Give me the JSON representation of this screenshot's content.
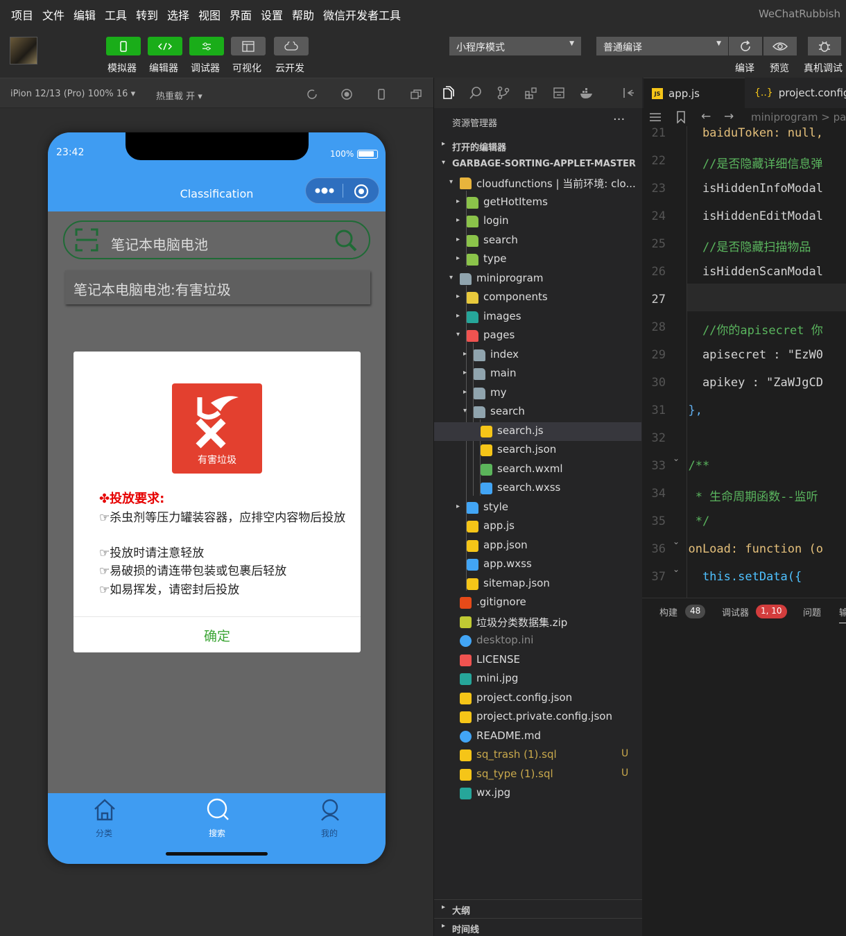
{
  "menu": {
    "items": [
      "项目",
      "文件",
      "编辑",
      "工具",
      "转到",
      "选择",
      "视图",
      "界面",
      "设置",
      "帮助",
      "微信开发者工具"
    ],
    "window_title": "WeChatRubbish"
  },
  "toolbar": {
    "buttons": [
      {
        "label": "模拟器",
        "icon": "phone-icon"
      },
      {
        "label": "编辑器",
        "icon": "code-icon"
      },
      {
        "label": "调试器",
        "icon": "sliders-icon"
      },
      {
        "label": "可视化",
        "icon": "layout-icon"
      },
      {
        "label": "云开发",
        "icon": "cloud-icon"
      }
    ],
    "mode_select": "小程序模式",
    "compile_select": "普通编译",
    "compile_label": "编译",
    "preview_label": "预览",
    "debug_label": "真机调试"
  },
  "simulator": {
    "device": "iPion 12/13 (Pro) 100% 16 ▾",
    "hotreload": "热重载 开 ▾"
  },
  "phone": {
    "time": "23:42",
    "battery": "100%",
    "title": "Classification",
    "search_value": "笔记本电脑电池",
    "result": "笔记本电脑电池:有害垃圾",
    "modal": {
      "logo_label": "有害垃圾",
      "req_title": "✤投放要求:",
      "requirements": [
        "☞杀虫剂等压力罐装容器，应排空内容物后投放",
        "☞投放时请注意轻放",
        "☞易破损的请连带包装或包裹后轻放",
        "☞如易挥发，请密封后投放"
      ],
      "confirm": "确定"
    },
    "tabs": [
      {
        "label": "分类"
      },
      {
        "label": "搜索"
      },
      {
        "label": "我的"
      }
    ]
  },
  "explorer": {
    "title": "资源管理器",
    "dots": "···",
    "open_editors": "打开的编辑器",
    "project": "GARBAGE-SORTING-APPLET-MASTER",
    "outline": "大纲",
    "timeline": "时间线",
    "tree": [
      {
        "name": "cloudfunctions | 当前环境: clo...",
        "depth": 1,
        "arrow": "▾",
        "icon": "folder-cloud-icon",
        "color": "#e8b43c"
      },
      {
        "name": "getHotItems",
        "depth": 2,
        "arrow": "▸",
        "icon": "folder-cloud-icon",
        "color": "#8bc34a"
      },
      {
        "name": "login",
        "depth": 2,
        "arrow": "▸",
        "icon": "folder-cloud-icon",
        "color": "#8bc34a"
      },
      {
        "name": "search",
        "depth": 2,
        "arrow": "▸",
        "icon": "folder-cloud-icon",
        "color": "#8bc34a"
      },
      {
        "name": "type",
        "depth": 2,
        "arrow": "▸",
        "icon": "folder-cloud-icon",
        "color": "#8bc34a"
      },
      {
        "name": "miniprogram",
        "depth": 1,
        "arrow": "▾",
        "icon": "folder-open-icon",
        "color": "#90a4ae"
      },
      {
        "name": "components",
        "depth": 2,
        "arrow": "▸",
        "icon": "folder-components-icon",
        "color": "#e8c93c"
      },
      {
        "name": "images",
        "depth": 2,
        "arrow": "▸",
        "icon": "folder-images-icon",
        "color": "#26a69a"
      },
      {
        "name": "pages",
        "depth": 2,
        "arrow": "▾",
        "icon": "folder-pages-icon",
        "color": "#ef5350"
      },
      {
        "name": "index",
        "depth": 3,
        "arrow": "▸",
        "icon": "folder-icon",
        "color": "#90a4ae"
      },
      {
        "name": "main",
        "depth": 3,
        "arrow": "▸",
        "icon": "folder-icon",
        "color": "#90a4ae"
      },
      {
        "name": "my",
        "depth": 3,
        "arrow": "▸",
        "icon": "folder-icon",
        "color": "#90a4ae"
      },
      {
        "name": "search",
        "depth": 3,
        "arrow": "▾",
        "icon": "folder-open-icon",
        "color": "#90a4ae"
      },
      {
        "name": "search.js",
        "depth": 4,
        "arrow": "",
        "icon": "js-file-icon",
        "color": "#f5c518",
        "selected": true
      },
      {
        "name": "search.json",
        "depth": 4,
        "arrow": "",
        "icon": "json-file-icon",
        "color": "#f5c518"
      },
      {
        "name": "search.wxml",
        "depth": 4,
        "arrow": "",
        "icon": "wxml-file-icon",
        "color": "#5bb55b"
      },
      {
        "name": "search.wxss",
        "depth": 4,
        "arrow": "",
        "icon": "wxss-file-icon",
        "color": "#42a5f5"
      },
      {
        "name": "style",
        "depth": 2,
        "arrow": "▸",
        "icon": "folder-style-icon",
        "color": "#42a5f5"
      },
      {
        "name": "app.js",
        "depth": 2,
        "arrow": "",
        "icon": "js-file-icon",
        "color": "#f5c518"
      },
      {
        "name": "app.json",
        "depth": 2,
        "arrow": "",
        "icon": "json-file-icon",
        "color": "#f5c518"
      },
      {
        "name": "app.wxss",
        "depth": 2,
        "arrow": "",
        "icon": "wxss-file-icon",
        "color": "#42a5f5"
      },
      {
        "name": "sitemap.json",
        "depth": 2,
        "arrow": "",
        "icon": "json-file-icon",
        "color": "#f5c518"
      },
      {
        "name": ".gitignore",
        "depth": 1,
        "arrow": "",
        "icon": "git-icon",
        "color": "#e64a19"
      },
      {
        "name": "垃圾分类数据集.zip",
        "depth": 1,
        "arrow": "",
        "icon": "zip-file-icon",
        "color": "#c0ca33"
      },
      {
        "name": "desktop.ini",
        "depth": 1,
        "arrow": "",
        "icon": "gear-file-icon",
        "color": "#42a5f5",
        "dim": true
      },
      {
        "name": "LICENSE",
        "depth": 1,
        "arrow": "",
        "icon": "license-icon",
        "color": "#ef5350"
      },
      {
        "name": "mini.jpg",
        "depth": 1,
        "arrow": "",
        "icon": "image-file-icon",
        "color": "#26a69a"
      },
      {
        "name": "project.config.json",
        "depth": 1,
        "arrow": "",
        "icon": "json-file-icon",
        "color": "#f5c518"
      },
      {
        "name": "project.private.config.json",
        "depth": 1,
        "arrow": "",
        "icon": "json-file-icon",
        "color": "#f5c518"
      },
      {
        "name": "README.md",
        "depth": 1,
        "arrow": "",
        "icon": "info-file-icon",
        "color": "#42a5f5"
      },
      {
        "name": "sq_trash (1).sql",
        "depth": 1,
        "arrow": "",
        "icon": "database-icon",
        "color": "#f5c518",
        "status": "U",
        "changed": true
      },
      {
        "name": "sq_type (1).sql",
        "depth": 1,
        "arrow": "",
        "icon": "database-icon",
        "color": "#f5c518",
        "status": "U",
        "changed": true
      },
      {
        "name": "wx.jpg",
        "depth": 1,
        "arrow": "",
        "icon": "image-file-icon",
        "color": "#26a69a"
      }
    ]
  },
  "editor": {
    "tabs": [
      {
        "label": "app.js",
        "icon": "js-file-icon"
      },
      {
        "label": "project.config.j",
        "icon": "json-file-icon"
      }
    ],
    "breadcrumb": "miniprogram > pag",
    "lines": [
      {
        "n": "21",
        "code": "    baiduToken: null,"
      },
      {
        "n": "22",
        "code": "    //是否隐藏详细信息弹"
      },
      {
        "n": "23",
        "code": "    isHiddenInfoModal"
      },
      {
        "n": "24",
        "code": "    isHiddenEditModal"
      },
      {
        "n": "25",
        "code": "    //是否隐藏扫描物品"
      },
      {
        "n": "26",
        "code": "    isHiddenScanModal"
      },
      {
        "n": "27",
        "code": ""
      },
      {
        "n": "28",
        "code": "    //你的apisecret 你"
      },
      {
        "n": "29",
        "code": "    apisecret : \"EzW0"
      },
      {
        "n": "30",
        "code": "    apikey : \"ZaWJgCD"
      },
      {
        "n": "31",
        "code": "  },"
      },
      {
        "n": "32",
        "code": ""
      },
      {
        "n": "33",
        "code": "  /**"
      },
      {
        "n": "34",
        "code": "   * 生命周期函数--监听"
      },
      {
        "n": "35",
        "code": "   */"
      },
      {
        "n": "36",
        "code": "  onLoad: function (o"
      },
      {
        "n": "37",
        "code": "    this.setData({"
      }
    ],
    "bottom": {
      "build": "构建",
      "build_count": "48",
      "debugger": "调试器",
      "debug_count": "1, 10",
      "problems": "问题",
      "output": "输"
    }
  },
  "colors": {
    "accent": "#1aad19",
    "phone_blue": "#3f9cf2",
    "danger": "#e3402f"
  }
}
